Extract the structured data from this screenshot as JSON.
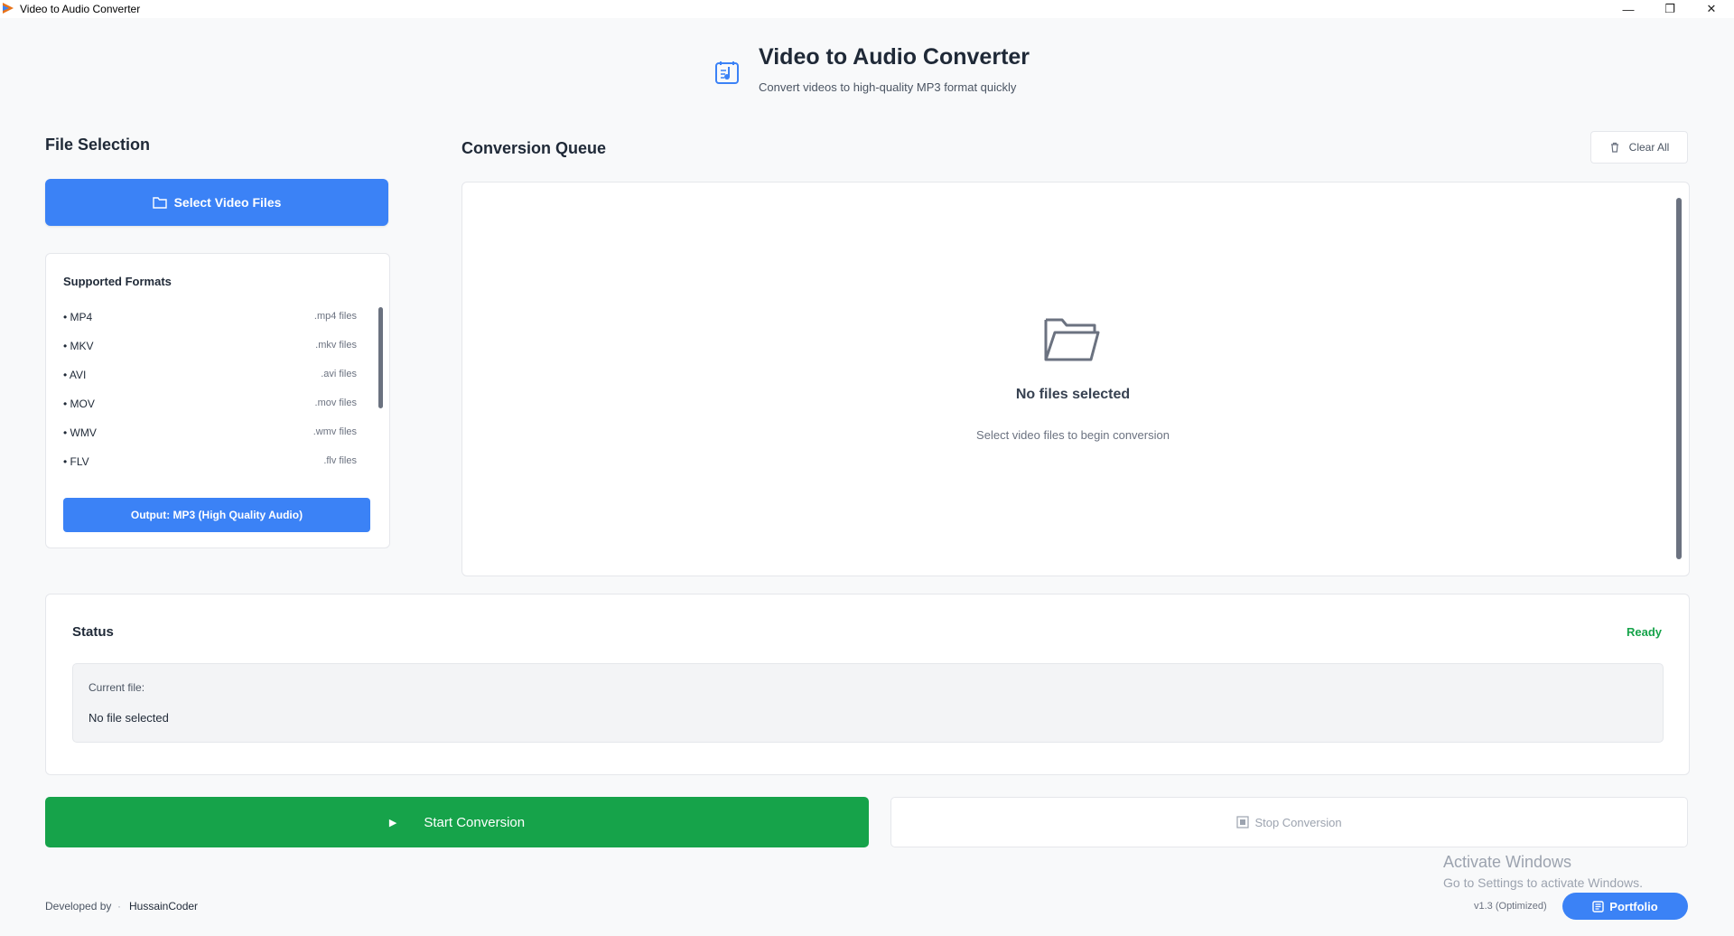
{
  "window": {
    "title": "Video to Audio Converter",
    "minimize": "—",
    "maximize": "❐",
    "close": "✕"
  },
  "header": {
    "title": "Video to Audio Converter",
    "subtitle": "Convert videos to high-quality MP3 format quickly",
    "logo_icon": "music-note-icon"
  },
  "file_selection": {
    "title": "File Selection",
    "select_button": "Select Video Files",
    "formats_title": "Supported Formats",
    "formats": [
      {
        "name": "• MP4",
        "ext": ".mp4 files"
      },
      {
        "name": "• MKV",
        "ext": ".mkv files"
      },
      {
        "name": "• AVI",
        "ext": ".avi files"
      },
      {
        "name": "• MOV",
        "ext": ".mov files"
      },
      {
        "name": "• WMV",
        "ext": ".wmv files"
      },
      {
        "name": "• FLV",
        "ext": ".flv files"
      }
    ],
    "output_button": "Output: MP3 (High Quality Audio)"
  },
  "queue": {
    "title": "Conversion Queue",
    "clear_button": "Clear All",
    "empty_title": "No files selected",
    "empty_subtitle": "Select video files to begin conversion"
  },
  "status": {
    "label": "Status",
    "value": "Ready",
    "current_file_label": "Current file:",
    "current_file_value": "No file selected"
  },
  "actions": {
    "start_button": "Start Conversion",
    "start_icon": "▶",
    "stop_button": "Stop Conversion"
  },
  "footer": {
    "developed_by": "Developed by",
    "separator": "·",
    "developer": "HussainCoder",
    "version": "v1.3 (Optimized)",
    "portfolio_button": "Portfolio"
  },
  "watermark": {
    "title": "Activate Windows",
    "subtitle": "Go to Settings to activate Windows."
  },
  "colors": {
    "accent": "#3b82f6",
    "success": "#16a34a",
    "background": "#f8f9fa"
  }
}
